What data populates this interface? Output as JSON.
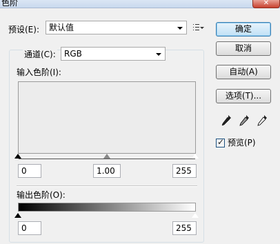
{
  "window": {
    "title": "色阶",
    "close_icon": "close-icon"
  },
  "preset": {
    "label": "预设(E):",
    "value": "默认值",
    "menu_icon": "preset-options-icon"
  },
  "channel": {
    "label": "通道(C):",
    "value": "RGB"
  },
  "input_levels": {
    "label": "输入色阶(I):",
    "black": "0",
    "gamma": "1.00",
    "white": "255"
  },
  "output_levels": {
    "label": "输出色阶(O):",
    "black": "0",
    "white": "255"
  },
  "buttons": {
    "ok": "确定",
    "cancel": "取消",
    "auto": "自动(A)",
    "options": "选项(T)..."
  },
  "eyedroppers": [
    "black-point-eyedropper-icon",
    "gray-point-eyedropper-icon",
    "white-point-eyedropper-icon"
  ],
  "preview": {
    "label": "预览(P)",
    "checked": true
  }
}
